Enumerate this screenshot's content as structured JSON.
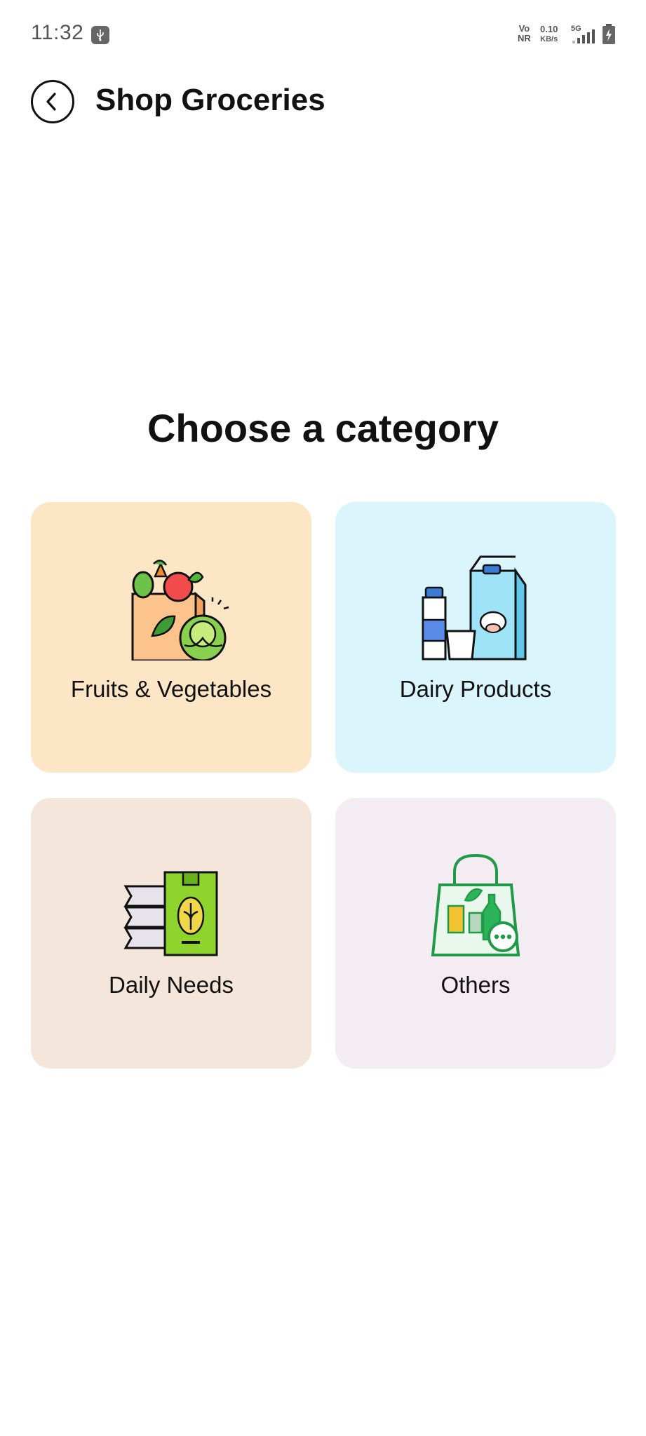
{
  "status_bar": {
    "time": "11:32",
    "volte_top": "Vo",
    "volte_bottom": "NR",
    "speed_value": "0.10",
    "speed_unit": "KB/s",
    "network": "5G"
  },
  "header": {
    "title": "Shop Groceries"
  },
  "main": {
    "heading": "Choose a category",
    "categories": [
      {
        "label": "Fruits & Vegetables",
        "icon": "fruits-vegetables-bag-icon",
        "color": "#fde6c5"
      },
      {
        "label": "Dairy Products",
        "icon": "milk-carton-bottle-icon",
        "color": "#daf5fc"
      },
      {
        "label": "Daily Needs",
        "icon": "grain-sacks-icon",
        "color": "#f4e6da"
      },
      {
        "label": "Others",
        "icon": "shopping-bag-more-icon",
        "color": "#f3ecf2"
      }
    ]
  }
}
